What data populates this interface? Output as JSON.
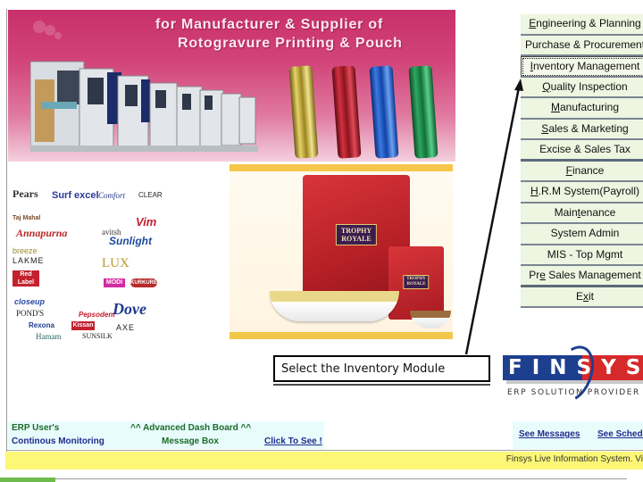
{
  "banner": {
    "title_line1": "for  Manufacturer & Supplier of",
    "title_line2": "Rotogravure Printing & Pouch",
    "roll_colors": [
      "#d8c458",
      "#c4202e",
      "#2a66d0",
      "#1f8a4a"
    ]
  },
  "brands": [
    "Pears",
    "Surf excel",
    "Taj Mahal",
    "Annapurna",
    "breeze",
    "LAKME",
    "Red Label",
    "closeup",
    "POND'S",
    "Rexona",
    "Kissan",
    "Hamam",
    "SUNSILK",
    "Comfort",
    "CLEAR",
    "Vim",
    "avitsh",
    "Sunlight",
    "LUX",
    "MODI",
    "KURKURE",
    "Pepsodent",
    "Dove",
    "AXE"
  ],
  "product": {
    "bag_label_line1": "TROPHY",
    "bag_label_line2": "ROYALE"
  },
  "menu": {
    "items": [
      {
        "label": "Engineering & Planning",
        "accel": "E"
      },
      {
        "label": "Purchase & Procurement",
        "accel": ""
      },
      {
        "label": "Inventory Management",
        "accel": "I",
        "focused": true
      },
      {
        "label": "Quality Inspection",
        "accel": "Q"
      },
      {
        "label": "Manufacturing",
        "accel": "M"
      },
      {
        "label": "Sales & Marketing",
        "accel": "S"
      },
      {
        "label": "Excise & Sales Tax",
        "accel": ""
      },
      {
        "label": "Finance",
        "accel": "F"
      },
      {
        "label": "H.R.M System(Payroll)",
        "accel": "H"
      },
      {
        "label": "Maintenance",
        "accel": "t"
      },
      {
        "label": "System Admin",
        "accel": ""
      },
      {
        "label": "MIS - Top Mgmt",
        "accel": "g"
      },
      {
        "label": "Pre Sales Management",
        "accel": "e"
      },
      {
        "label": "Exit",
        "accel": "x"
      }
    ]
  },
  "callout": {
    "text": "Select the Inventory Module"
  },
  "logo": {
    "wordmark": "FINSYS",
    "tagline": "ERP SOLUTION PROVIDER",
    "colors": {
      "blue": "#1c3f8e",
      "red": "#d62a2a"
    }
  },
  "dashboard": {
    "erp_users": "ERP User's",
    "continous_monitoring": "Continous Monitoring",
    "advanced_dash": "^^ Advanced Dash Board ^^",
    "message_box": "Message Box",
    "click_to_see": "Click To See !",
    "see_messages": "See Messages",
    "see_schedule": "See Schedule"
  },
  "ticker": {
    "text": "Finsys Live Information System. Vi"
  }
}
